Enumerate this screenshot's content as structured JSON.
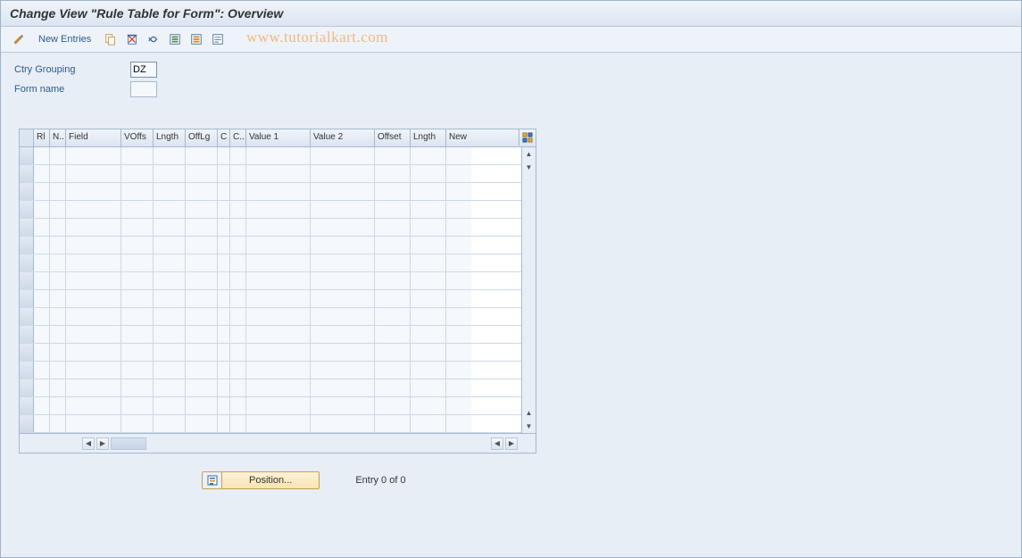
{
  "title": "Change View \"Rule Table for Form\": Overview",
  "toolbar": {
    "new_entries": "New Entries"
  },
  "watermark": "www.tutorialkart.com",
  "fields": {
    "ctry_grouping_label": "Ctry Grouping",
    "ctry_grouping_value": "DZ",
    "form_name_label": "Form name",
    "form_name_value": ""
  },
  "table": {
    "columns": [
      {
        "label": "Rl",
        "width": 18
      },
      {
        "label": "N..",
        "width": 18
      },
      {
        "label": "Field",
        "width": 62
      },
      {
        "label": "VOffs",
        "width": 36
      },
      {
        "label": "Lngth",
        "width": 36
      },
      {
        "label": "OffLg",
        "width": 36
      },
      {
        "label": "C",
        "width": 14
      },
      {
        "label": "C..",
        "width": 18
      },
      {
        "label": "Value 1",
        "width": 72
      },
      {
        "label": "Value 2",
        "width": 72
      },
      {
        "label": "Offset",
        "width": 40
      },
      {
        "label": "Lngth",
        "width": 40
      },
      {
        "label": "New",
        "width": 28
      }
    ],
    "row_count": 16
  },
  "bottom": {
    "position_label": "Position...",
    "entry_count": "Entry 0 of 0"
  }
}
